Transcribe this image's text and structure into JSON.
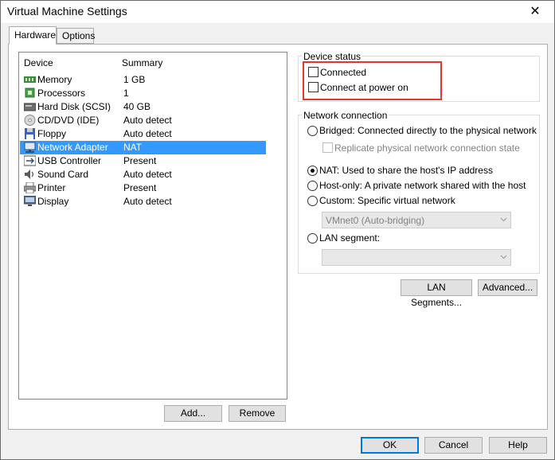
{
  "window": {
    "title": "Virtual Machine Settings",
    "close_glyph": "✕"
  },
  "tabs": [
    {
      "label": "Hardware"
    },
    {
      "label": "Options"
    }
  ],
  "device_list": {
    "headers": {
      "device": "Device",
      "summary": "Summary"
    },
    "rows": [
      {
        "device": "Memory",
        "summary": "1 GB",
        "icon": "memory-icon"
      },
      {
        "device": "Processors",
        "summary": "1",
        "icon": "processor-icon"
      },
      {
        "device": "Hard Disk (SCSI)",
        "summary": "40 GB",
        "icon": "hard-disk-icon"
      },
      {
        "device": "CD/DVD (IDE)",
        "summary": "Auto detect",
        "icon": "cd-dvd-icon"
      },
      {
        "device": "Floppy",
        "summary": "Auto detect",
        "icon": "floppy-icon"
      },
      {
        "device": "Network Adapter",
        "summary": "NAT",
        "icon": "network-adapter-icon"
      },
      {
        "device": "USB Controller",
        "summary": "Present",
        "icon": "usb-icon"
      },
      {
        "device": "Sound Card",
        "summary": "Auto detect",
        "icon": "speaker-icon"
      },
      {
        "device": "Printer",
        "summary": "Present",
        "icon": "printer-icon"
      },
      {
        "device": "Display",
        "summary": "Auto detect",
        "icon": "monitor-icon"
      }
    ],
    "selected": "Network Adapter"
  },
  "list_buttons": {
    "add": "Add...",
    "remove": "Remove"
  },
  "device_status": {
    "title": "Device status",
    "connected": {
      "label": "Connected",
      "checked": false
    },
    "connect_at_power_on": {
      "label": "Connect at power on",
      "checked": false
    }
  },
  "network_connection": {
    "title": "Network connection",
    "bridged": "Bridged: Connected directly to the physical network",
    "replicate": "Replicate physical network connection state",
    "nat": "NAT: Used to share the host's IP address",
    "host_only": "Host-only: A private network shared with the host",
    "custom": "Custom: Specific virtual network",
    "custom_select_value": "VMnet0 (Auto-bridging)",
    "lan_segment": "LAN segment:",
    "lan_select_value": "",
    "selected": "nat"
  },
  "adapter_buttons": {
    "lan_segments": "LAN Segments...",
    "advanced": "Advanced..."
  },
  "dialog_buttons": {
    "ok": "OK",
    "cancel": "Cancel",
    "help": "Help"
  },
  "colors": {
    "selection": "#3399ff",
    "highlight_box": "#e8332e",
    "default_button_border": "#0078d7"
  }
}
